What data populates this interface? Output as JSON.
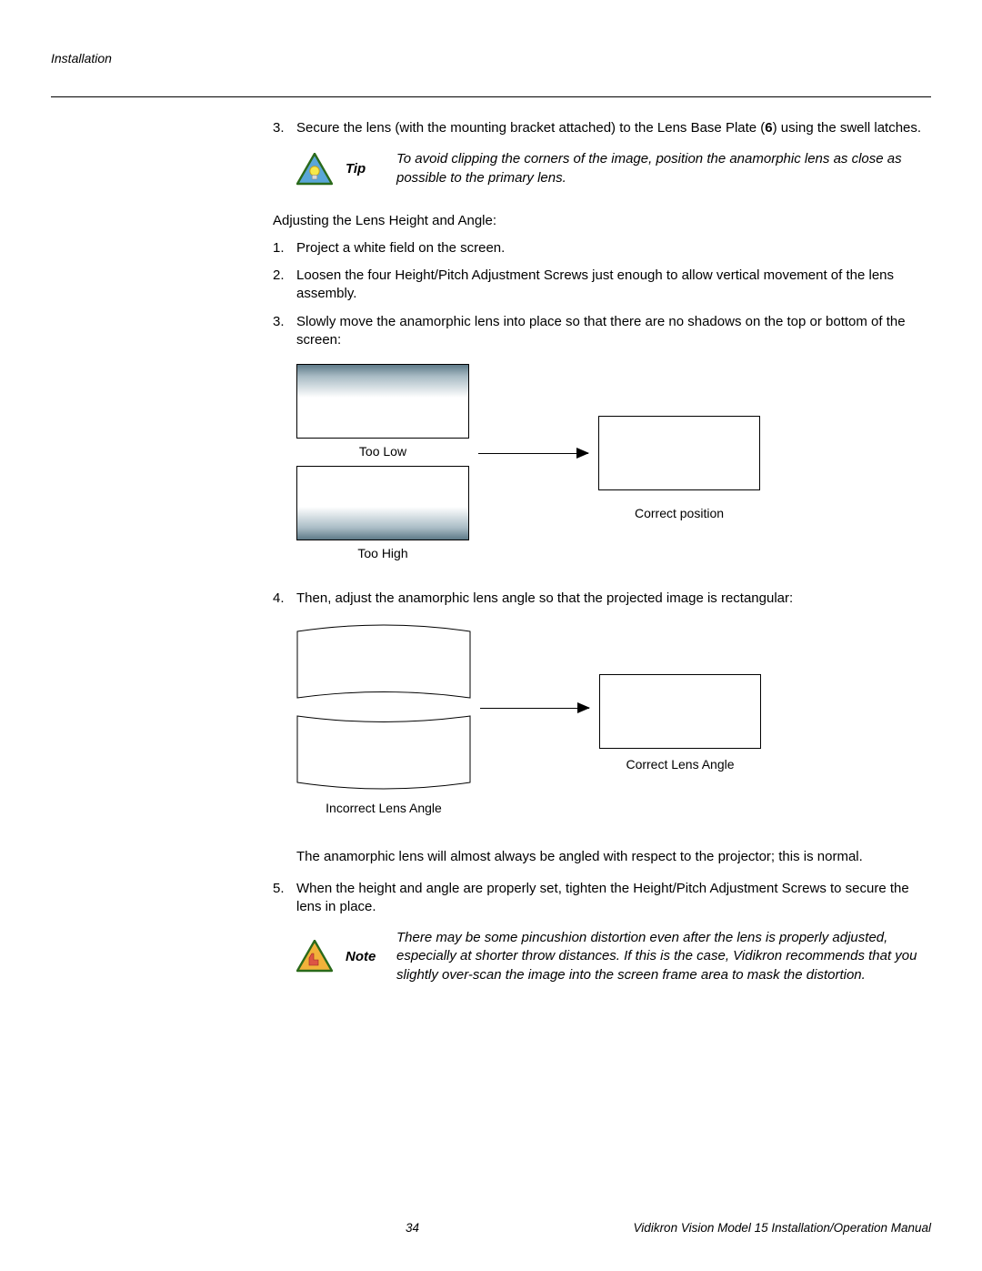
{
  "header": {
    "section": "Installation"
  },
  "step3": {
    "num": "3.",
    "text_a": "Secure the lens (with the mounting bracket attached) to the Lens Base Plate (",
    "bold": "6",
    "text_b": ") using the swell latches."
  },
  "tip": {
    "label": "Tip",
    "text": "To avoid clipping the corners of the image, position the anamorphic lens as close as possible to the primary lens."
  },
  "subhead": "Adjusting the Lens Height and Angle:",
  "adj1": {
    "num": "1.",
    "text": "Project a white field on the screen."
  },
  "adj2": {
    "num": "2.",
    "text": "Loosen the four Height/Pitch Adjustment Screws just enough to allow vertical movement of the lens assembly."
  },
  "adj3": {
    "num": "3.",
    "text": "Slowly move the anamorphic lens into place so that there are no shadows on the top or bottom of the screen:"
  },
  "fig1": {
    "too_low": "Too Low",
    "too_high": "Too High",
    "correct": "Correct position"
  },
  "adj4": {
    "num": "4.",
    "text": "Then, adjust the anamorphic lens angle so that the projected image is rectangular:"
  },
  "fig2": {
    "incorrect": "Incorrect Lens Angle",
    "correct": "Correct Lens Angle"
  },
  "para": "The anamorphic lens will almost always be angled with respect to the projector; this is normal.",
  "adj5": {
    "num": "5.",
    "text": "When the height and angle are properly set, tighten the Height/Pitch Adjustment Screws to secure the lens in place."
  },
  "note": {
    "label": "Note",
    "text": "There may be some pincushion distortion even after the lens is properly adjusted, especially at shorter throw distances. If this is the case, Vidikron recommends that you slightly over-scan the image into the screen frame area to mask the distortion."
  },
  "footer": {
    "page": "34",
    "title": "Vidikron Vision Model 15 Installation/Operation Manual"
  }
}
